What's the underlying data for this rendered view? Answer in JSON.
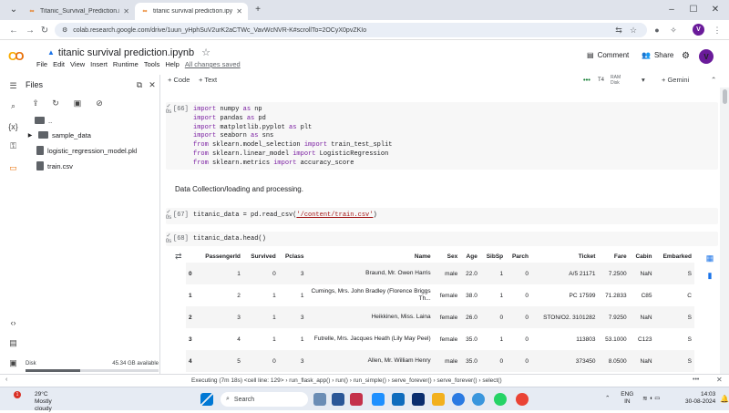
{
  "browser": {
    "tabs": [
      {
        "label": "Titanic_Survival_Prediction.ipynb",
        "active": false
      },
      {
        "label": "titanic survival prediction.ipynb",
        "active": true
      }
    ],
    "url": "colab.research.google.com/drive/1uun_yHphSuV2urK2aCTWc_VavWcNVR-K#scrollTo=2OCyX0pvZKIo",
    "profile_initial": "V"
  },
  "colab": {
    "title": "titanic survival prediction.ipynb",
    "menus": [
      "File",
      "Edit",
      "View",
      "Insert",
      "Runtime",
      "Tools",
      "Help"
    ],
    "saved_status": "All changes saved",
    "comment_label": "Comment",
    "share_label": "Share",
    "add_code": "+ Code",
    "add_text": "+ Text",
    "gemini_label": "+ Gemini",
    "ram_label": "RAM",
    "disk_mini_label": "Disk",
    "t4_label": "T4"
  },
  "files": {
    "title": "Files",
    "parent": "..",
    "items": [
      {
        "name": "sample_data",
        "type": "folder"
      },
      {
        "name": "logistic_regression_model.pkl",
        "type": "file"
      },
      {
        "name": "train.csv",
        "type": "file"
      }
    ],
    "disk_label": "Disk",
    "disk_available": "45.34 GB available",
    "disk_fraction": 0.41
  },
  "cells": {
    "c66": {
      "exec": "[66]",
      "lines": [
        [
          [
            "kw",
            "import"
          ],
          [
            "t",
            " numpy "
          ],
          [
            "kw",
            "as"
          ],
          [
            "t",
            " np"
          ]
        ],
        [
          [
            "kw",
            "import"
          ],
          [
            "t",
            " pandas "
          ],
          [
            "kw",
            "as"
          ],
          [
            "t",
            " pd"
          ]
        ],
        [
          [
            "kw",
            "import"
          ],
          [
            "t",
            " matplotlib.pyplot "
          ],
          [
            "kw",
            "as"
          ],
          [
            "t",
            " plt"
          ]
        ],
        [
          [
            "kw",
            "import"
          ],
          [
            "t",
            " seaborn "
          ],
          [
            "kw",
            "as"
          ],
          [
            "t",
            " sns"
          ]
        ],
        [
          [
            "kw",
            "from"
          ],
          [
            "t",
            " sklearn.model_selection "
          ],
          [
            "kw",
            "import"
          ],
          [
            "t",
            " train_test_split"
          ]
        ],
        [
          [
            "kw",
            "from"
          ],
          [
            "t",
            " sklearn.linear_model "
          ],
          [
            "kw",
            "import"
          ],
          [
            "t",
            " LogisticRegression"
          ]
        ],
        [
          [
            "kw",
            "from"
          ],
          [
            "t",
            " sklearn.metrics "
          ],
          [
            "kw",
            "import"
          ],
          [
            "t",
            " accuracy_score"
          ]
        ]
      ]
    },
    "text1": "Data Collection/loading and processing.",
    "c67": {
      "exec": "[67]",
      "lines": [
        [
          [
            "t",
            "titanic_data = pd.read_csv("
          ],
          [
            "str",
            "'/content/train.csv'"
          ],
          [
            "t",
            ")"
          ]
        ]
      ]
    },
    "c68": {
      "exec": "[68]",
      "lines": [
        [
          [
            "t",
            "titanic_data.head()"
          ]
        ]
      ]
    },
    "time_labels": [
      "0s",
      "0s",
      "0s"
    ]
  },
  "dataframe": {
    "columns": [
      "",
      "PassengerId",
      "Survived",
      "Pclass",
      "Name",
      "Sex",
      "Age",
      "SibSp",
      "Parch",
      "Ticket",
      "Fare",
      "Cabin",
      "Embarked"
    ],
    "rows": [
      [
        "0",
        "1",
        "0",
        "3",
        "Braund, Mr. Owen Harris",
        "male",
        "22.0",
        "1",
        "0",
        "A/5 21171",
        "7.2500",
        "NaN",
        "S"
      ],
      [
        "1",
        "2",
        "1",
        "1",
        "Cumings, Mrs. John Bradley (Florence Briggs Th...",
        "female",
        "38.0",
        "1",
        "0",
        "PC 17599",
        "71.2833",
        "C85",
        "C"
      ],
      [
        "2",
        "3",
        "1",
        "3",
        "Heikkinen, Miss. Laina",
        "female",
        "26.0",
        "0",
        "0",
        "STON/O2. 3101282",
        "7.9250",
        "NaN",
        "S"
      ],
      [
        "3",
        "4",
        "1",
        "1",
        "Futrelle, Mrs. Jacques Heath (Lily May Peel)",
        "female",
        "35.0",
        "1",
        "0",
        "113803",
        "53.1000",
        "C123",
        "S"
      ],
      [
        "4",
        "5",
        "0",
        "3",
        "Allen, Mr. William Henry",
        "male",
        "35.0",
        "0",
        "0",
        "373450",
        "8.0500",
        "NaN",
        "S"
      ]
    ]
  },
  "status": {
    "text": "Executing (7m 18s)  <cell line: 129> › run_flask_app() › run() › run_simple() › serve_forever() › serve_forever() › select()"
  },
  "taskbar": {
    "weather_temp": "29°C",
    "weather_desc": "Mostly cloudy",
    "notif_count": "1",
    "search_placeholder": "Search",
    "lang": "ENG",
    "region": "IN",
    "time": "14:03",
    "date": "30-08-2024"
  }
}
